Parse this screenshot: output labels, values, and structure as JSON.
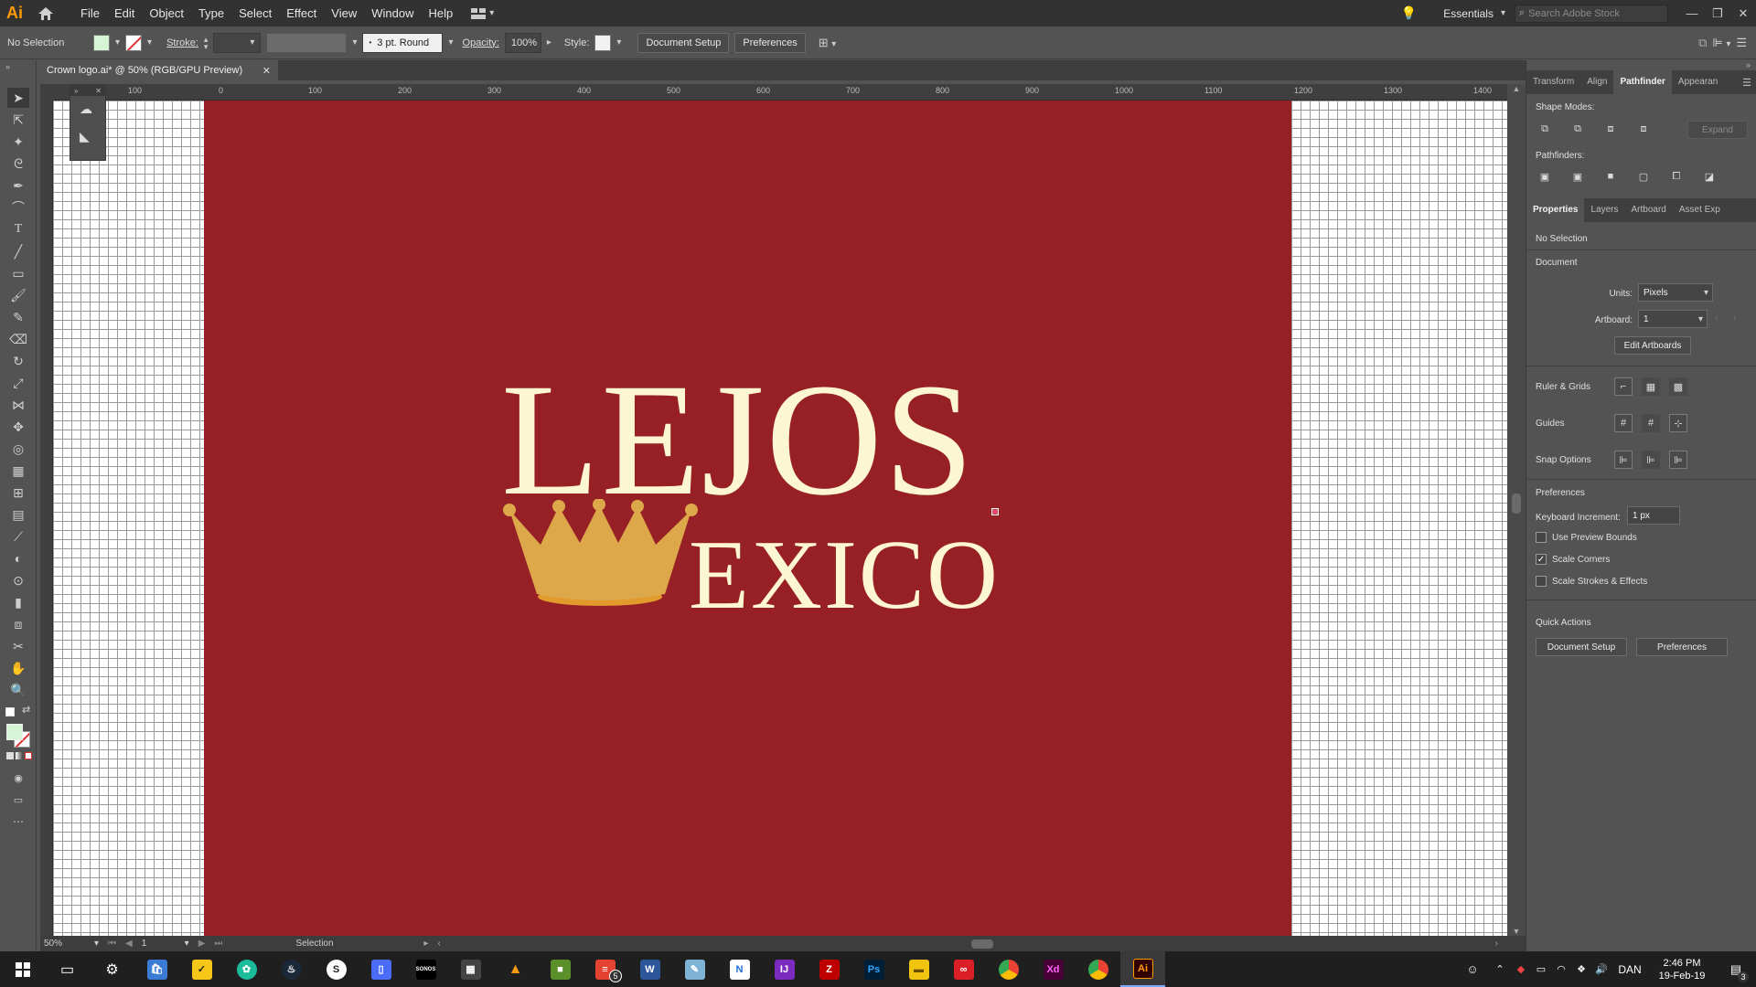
{
  "app": {
    "logo": "Ai",
    "workspace": "Essentials",
    "search_placeholder": "Search Adobe Stock"
  },
  "menu": [
    "File",
    "Edit",
    "Object",
    "Type",
    "Select",
    "Effect",
    "View",
    "Window",
    "Help"
  ],
  "control_bar": {
    "selection": "No Selection",
    "stroke_label": "Stroke:",
    "brush": "3 pt. Round",
    "opacity_label": "Opacity:",
    "opacity_value": "100%",
    "style_label": "Style:",
    "document_setup": "Document Setup",
    "preferences": "Preferences"
  },
  "document": {
    "tab_title": "Crown logo.ai* @ 50% (RGB/GPU Preview)"
  },
  "ruler": {
    "ticks": [
      "100",
      "0",
      "100",
      "200",
      "300",
      "400",
      "500",
      "600",
      "700",
      "800",
      "900",
      "1000",
      "1100",
      "1200",
      "1300",
      "1400"
    ]
  },
  "artwork": {
    "line1": "LEJOS",
    "line2": "EXICO",
    "background_color": "#971f26",
    "text_color": "#fcf6d2",
    "crown_color": "#dca84a"
  },
  "status": {
    "zoom": "50%",
    "artboard": "1",
    "tool": "Selection"
  },
  "panels": {
    "top_tabs": [
      "Transform",
      "Align",
      "Pathfinder",
      "Appearan"
    ],
    "shape_modes_label": "Shape Modes:",
    "expand_label": "Expand",
    "pathfinders_label": "Pathfinders:",
    "props_tabs": [
      "Properties",
      "Layers",
      "Artboard",
      "Asset Exp"
    ],
    "no_selection": "No Selection",
    "document_label": "Document",
    "units_label": "Units:",
    "units_value": "Pixels",
    "artboard_label": "Artboard:",
    "artboard_value": "1",
    "edit_artboards": "Edit Artboards",
    "ruler_grids": "Ruler & Grids",
    "guides": "Guides",
    "snap_options": "Snap Options",
    "preferences_label": "Preferences",
    "keyboard_increment_label": "Keyboard Increment:",
    "keyboard_increment_value": "1 px",
    "use_preview_bounds": "Use Preview Bounds",
    "scale_corners": "Scale Corners",
    "scale_strokes": "Scale Strokes & Effects",
    "quick_actions": "Quick Actions",
    "qa_document_setup": "Document Setup",
    "qa_preferences": "Preferences"
  },
  "taskbar": {
    "language": "DAN",
    "time": "2:46 PM",
    "date": "19-Feb-19",
    "notifications": "3",
    "badge": "5"
  }
}
